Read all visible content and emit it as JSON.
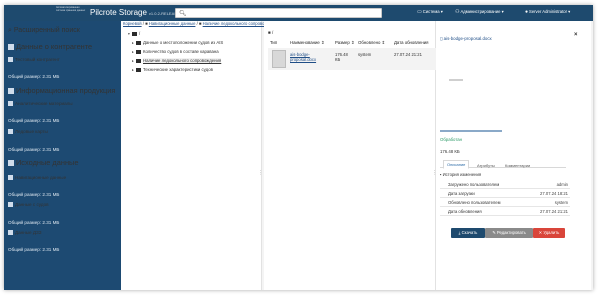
{
  "app": {
    "logo_small": "Автоматизированная система хранения данных",
    "title": "Pilcrote Storage",
    "version": "v1.0.2-RELEASE",
    "search_icon": "search-icon"
  },
  "top_menu": {
    "system": "Система",
    "admin": "Администрирование",
    "user": "Server Administrator"
  },
  "sidebar": {
    "search": "Расширенный поиск",
    "blocks": [
      {
        "head": "Данные о контрагенте",
        "sub": "Тестовый контрагент",
        "size": "Общий размер: 2.31 МБ"
      },
      {
        "head": "Информационная продукция",
        "sub": "Аналитические материалы",
        "size": "Общий размер: 2.31 МБ"
      },
      {
        "head": "",
        "sub": "Ледовые карты",
        "size": "Общий размер: 2.31 МБ"
      },
      {
        "head": "Исходные данные",
        "sub": "Навигационные данные",
        "size": "Общий размер: 2.31 МБ"
      },
      {
        "head": "",
        "sub": "Данные с судов",
        "size": "Общий размер: 2.31 МБ"
      },
      {
        "head": "",
        "sub": "Данные ДЗЗ",
        "size": "Общий размер: 2.31 МБ"
      }
    ]
  },
  "breadcrumb": {
    "items": [
      "Корневой",
      "Навигационные данные",
      "Наличие ледокольного сопровождения"
    ]
  },
  "tree": {
    "root": "/",
    "items": [
      {
        "label": "Данные о местоположении судов из AIS",
        "selected": false
      },
      {
        "label": "Количество судов в составе каравана",
        "selected": false
      },
      {
        "label": "Наличие ледокольного сопровождения",
        "selected": true
      },
      {
        "label": "Технические характеристики судов",
        "selected": false
      }
    ]
  },
  "files": {
    "root": "/",
    "headers": {
      "type": "Тип",
      "name": "Наименование",
      "size": "Размер",
      "updated": "Обновлено",
      "date": "Дата обновления"
    },
    "rows": [
      {
        "name": "ais-bodge-proposal.docx",
        "size": "176.48 КБ",
        "updated": "system",
        "date": "27.07.24 21:21"
      }
    ]
  },
  "detail": {
    "file_name": "ais-bodge-proposal.docx",
    "status": "Обработан",
    "size": "176.48 КБ",
    "progress": 1.0,
    "tabs": [
      "Описание",
      "Атрибуты",
      "Комментарии"
    ],
    "active_tab": 0,
    "history_label": "История изменения",
    "properties": [
      {
        "key": "Загружено пользователем",
        "value": "admin"
      },
      {
        "key": "Дата загрузки",
        "value": "27.07.24 18:21"
      },
      {
        "key": "Обновлено пользователем",
        "value": "system"
      },
      {
        "key": "Дата обновления",
        "value": "27.07.24 21:21"
      }
    ],
    "buttons": {
      "download": "Скачать",
      "edit": "Редактировать",
      "delete": "Удалить"
    }
  },
  "colors": {
    "header": "#1e4a6e",
    "sidebar": "#1d4a72",
    "status_ok": "#2f9c6a",
    "danger": "#d9453a"
  }
}
